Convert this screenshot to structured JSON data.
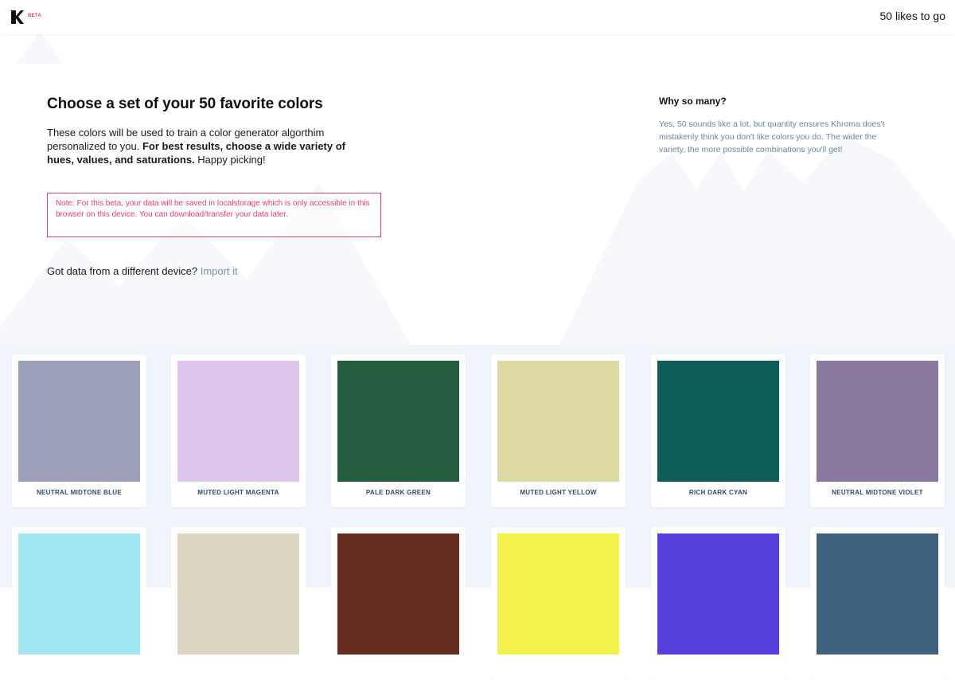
{
  "header": {
    "logo_icon": "khroma-k-logo-icon",
    "beta_label": "BETA",
    "likes_text": "50 likes to go"
  },
  "intro": {
    "title": "Choose a set of your 50 favorite colors",
    "body_start": "These colors will be used to train a color generator algorthim personalized to you. ",
    "body_bold": "For best results, choose a wide variety of hues, values, and saturations.",
    "body_end": " Happy picking!"
  },
  "note": {
    "text": "Note: For this beta, your data will be saved in localstorage which is only accessible in this browser on this device. You can download/transfer your data later."
  },
  "import": {
    "prompt": "Got data from a different device? ",
    "link_label": "Import it"
  },
  "why": {
    "title": "Why so many?",
    "text": "Yes, 50 sounds like a lot, but quantity ensures Khroma does't mistakenly think you don't like colors you do. The wider the variety, the more possible combinations you'll get!"
  },
  "colors": {
    "accent": "#e83e6c",
    "link": "#7a93ad",
    "palette_bg": "#f0f4fb",
    "card_label": "#2d4a6e"
  },
  "swatches": [
    {
      "label": "NEUTRAL MIDTONE BLUE",
      "color": "#9c9fba"
    },
    {
      "label": "MUTED LIGHT MAGENTA",
      "color": "#ddc5ec"
    },
    {
      "label": "PALE DARK GREEN",
      "color": "#255c40"
    },
    {
      "label": "MUTED LIGHT YELLOW",
      "color": "#ddd9a3"
    },
    {
      "label": "RICH DARK CYAN",
      "color": "#0d5e58"
    },
    {
      "label": "NEUTRAL MIDTONE VIOLET",
      "color": "#8a799e"
    },
    {
      "label": "",
      "color": "#a2e6f2"
    },
    {
      "label": "",
      "color": "#ddd6c0"
    },
    {
      "label": "",
      "color": "#662d20"
    },
    {
      "label": "",
      "color": "#f2f24a"
    },
    {
      "label": "",
      "color": "#5540dd"
    },
    {
      "label": "",
      "color": "#3e617f"
    }
  ]
}
